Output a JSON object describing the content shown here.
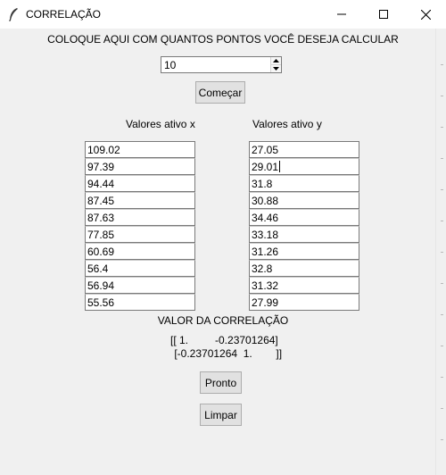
{
  "window": {
    "title": "CORRELAÇÃO",
    "icon": "tk-feather-icon",
    "controls": [
      "minimize-icon",
      "maximize-icon",
      "close-icon"
    ]
  },
  "form": {
    "instruction": "COLOQUE AQUI COM QUANTOS PONTOS VOCÊ DESEJA CALCULAR",
    "points_value": "10",
    "start_label": "Começar"
  },
  "columns": {
    "x_header": "Valores ativo x",
    "y_header": "Valores ativo y",
    "x_values": [
      "109.02",
      "97.39",
      "94.44",
      "87.45",
      "87.63",
      "77.85",
      "60.69",
      "56.4",
      "56.94",
      "55.56"
    ],
    "y_values": [
      "27.05",
      "29.01",
      "31.8",
      "30.88",
      "34.46",
      "33.18",
      "31.26",
      "32.8",
      "31.32",
      "27.99"
    ]
  },
  "result": {
    "title": "VALOR DA CORRELAÇÃO",
    "line1": "[[ 1.         -0.23701264]",
    "line2": " [-0.23701264  1.        ]]"
  },
  "actions": {
    "done_label": "Pronto",
    "clear_label": "Limpar"
  }
}
